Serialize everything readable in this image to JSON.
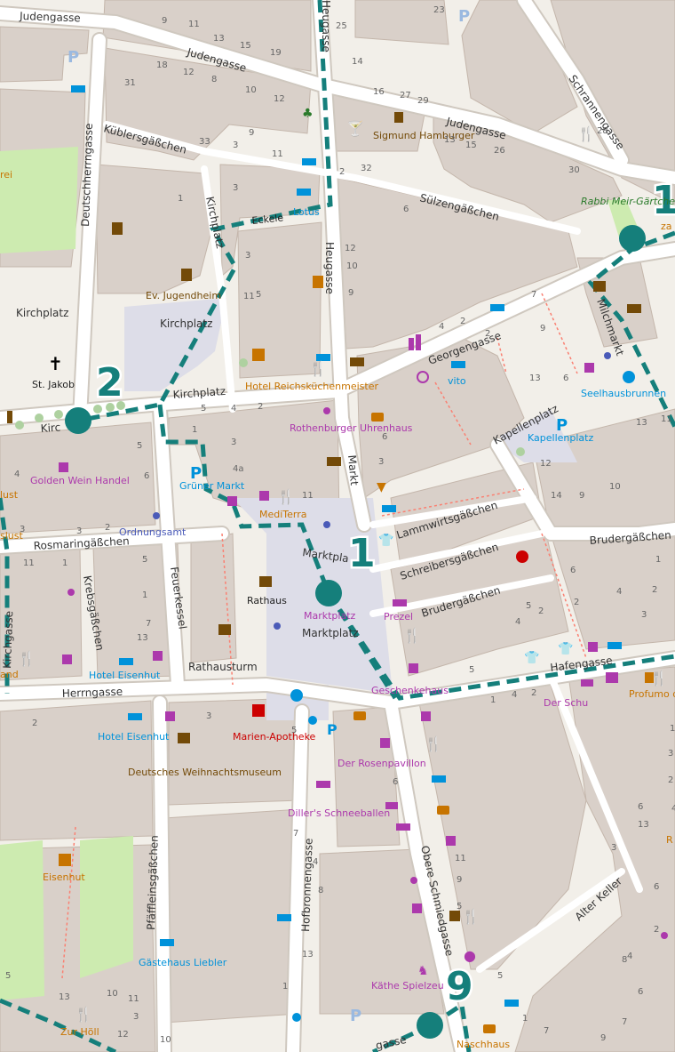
{
  "map": {
    "colors": {
      "background": "#f2efe9",
      "building": "#d9d0c9",
      "building_stroke": "#c4b6ab",
      "road": "#ffffff",
      "road_casing": "#cfc8bf",
      "square": "#dddde8",
      "park": "#cdebb0",
      "route": "#157f7b",
      "footway": "#fa8072"
    },
    "streets": {
      "judengasse_1": "Judengasse",
      "judengasse_2": "Judengasse",
      "judengasse_3": "Judengasse",
      "kueblersgaesschen": "Küblersgäßchen",
      "deutschherrngasse": "Deutschherrngasse",
      "schrannengasse": "Schrannengasse",
      "suelzengaesschen": "Sülzengäßchen",
      "kirchplatz_1": "Kirchplatz",
      "kirchplatz_2": "Kirchplatz",
      "kirchplatz_3": "Kirchplatz",
      "kirchplatz_4": "Kirchplatz",
      "kirchplatz_vert": "Kirchplatz",
      "kirchplatz_short": "Kirc",
      "eckele": "Eckele",
      "heugasse_1": "Heugasse",
      "heugasse_2": "Heugasse",
      "georgengasse": "Georgengasse",
      "markt": "Markt",
      "kapellenplatz_street": "Kapellenplatz",
      "lammwirtsgaesschen": "Lammwirtsgäßchen",
      "schreibersgaesschen": "Schreibersgäßchen",
      "brudergaesschen_1": "Brudergäßchen",
      "brudergaesschen_2": "Brudergäßchen",
      "rosmaringaesschen": "Rosmaringäßchen",
      "krebsgaesschen": "Krebsgäßchen",
      "feuerkessel": "Feuerkessel",
      "marktplatz_street": "Marktpla",
      "hafengasse": "Hafengasse",
      "herrngasse": "Herrngasse",
      "obere_schmiedgasse": "Obere Schmiedgasse",
      "pfaeffleinsgaesschen": "Pfäffleinsgäßchen",
      "hofbronnengasse": "Hofbronnengasse",
      "alter_keller": "Alter Keller",
      "kirchgasse_vert": "Kirchgasse",
      "milchmarkt": "Milchmarkt",
      "bottom_street": "gasse"
    },
    "places": {
      "st_jakob": "St. Jakob",
      "kirchplatz_square": "Kirchplatz",
      "rathaus": "Rathaus",
      "rathausturm": "Rathausturm",
      "marktplatz_1": "Marktplatz",
      "marktplatz_2": "Marktplatz",
      "ev_jugendheim": "Ev. Jugendheim",
      "sigmund_hamburger": "Sigmund Hamburger",
      "rabbi_meir_gaertchen": "Rabbi Meir-Gärtchen",
      "hotel_reichskuechenmeister": "Hotel Reichsküchenmeister",
      "lotus": "Lotus",
      "vito": "vito",
      "seelhausbrunnen": "Seelhausbrunnen",
      "kapellenplatz_parking": "Kapellenplatz",
      "rothenburger_uhrenhaus": "Rothenburger Uhrenhaus",
      "golden_wein_handel": "Golden Wein Handel",
      "gruener_markt": "Grüner Markt",
      "mediterra": "MediTerra",
      "ordnungsamt": "Ordnungsamt",
      "prezel": "Prezel",
      "geschenkehaus": "Geschenkehaus",
      "der_schu": "Der Schu",
      "profumo": "Profumo di Pasta \"da Giusep",
      "hotel_eisenhut_1": "Hotel Eisenhut",
      "hotel_eisenhut_2": "Hotel Eisenhut",
      "deutsches_weihnachtsmuseum": "Deutsches Weihnachtsmuseum",
      "marien_apotheke": "Marien-Apotheke",
      "der_rosenpavillon": "Der Rosenpavillon",
      "dillers_schneeballen": "Diller's Schneeballen",
      "eisenhut": "Eisenhut",
      "gaestehaus_liebler": "Gästehaus Liebler",
      "kaethe_spielzeug": "Käthe Spielzeu",
      "naschhaus": "Naschhaus",
      "zur_hoell": "Zur Höll",
      "left_lust_1": "lust",
      "left_lust_2": "slust",
      "left_and": "and",
      "left_rei": "rei",
      "right_za": "za",
      "right_ra": "R",
      "sur": "Sülz"
    },
    "house_numbers": [
      "9",
      "11",
      "13",
      "15",
      "19",
      "23",
      "25",
      "18",
      "12",
      "8",
      "10",
      "12",
      "14",
      "16",
      "27",
      "29",
      "31",
      "33",
      "3",
      "9",
      "11",
      "13",
      "15",
      "26",
      "28",
      "30",
      "2",
      "32",
      "3",
      "1",
      "3",
      "5",
      "12",
      "10",
      "9",
      "6",
      "4",
      "2",
      "2",
      "7",
      "9",
      "11",
      "13",
      "6",
      "5",
      "4",
      "2",
      "1",
      "3",
      "4a",
      "6",
      "3",
      "5",
      "6",
      "4",
      "3",
      "3",
      "2",
      "5",
      "1",
      "7",
      "11",
      "13",
      "9",
      "10",
      "13",
      "11",
      "12",
      "14",
      "1",
      "2",
      "4",
      "3",
      "6",
      "2",
      "5",
      "2",
      "4",
      "5",
      "1",
      "4",
      "2",
      "1",
      "3",
      "2",
      "4",
      "6",
      "13",
      "11",
      "1",
      "2",
      "3",
      "5",
      "6",
      "11",
      "9",
      "5",
      "7",
      "4",
      "8",
      "13",
      "1",
      "10",
      "13",
      "11",
      "3",
      "12",
      "10",
      "5",
      "3",
      "6",
      "2",
      "4",
      "6",
      "7",
      "8",
      "7",
      "9",
      "1",
      "5",
      "3",
      "10",
      "13",
      "15",
      "10",
      "4",
      "8",
      "9",
      "6"
    ],
    "route": {
      "stops": [
        {
          "number": "1",
          "name": "Marktplatz stop"
        },
        {
          "number": "2",
          "name": "Kirchplatz stop"
        },
        {
          "number": "9",
          "name": "south stop"
        },
        {
          "number": "1",
          "name": "north-east stop"
        }
      ]
    }
  }
}
